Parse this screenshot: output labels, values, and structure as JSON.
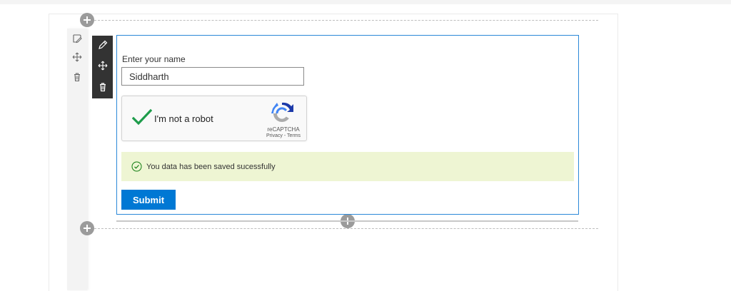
{
  "form": {
    "name_label": "Enter your name",
    "name_value": "Siddharth"
  },
  "recaptcha": {
    "checkbox_label": "I'm not a robot",
    "brand": "reCAPTCHA",
    "privacy_link": "Privacy",
    "separator": " - ",
    "terms_link": "Terms",
    "checked": true
  },
  "status": {
    "message": "You data has been saved sucessfully"
  },
  "actions": {
    "submit_label": "Submit"
  },
  "icons": {
    "section_left": [
      "edit-section-icon",
      "move-section-icon",
      "delete-section-icon"
    ],
    "toolbar": [
      "pencil-icon",
      "move-icon",
      "trash-icon"
    ],
    "add": "plus-icon",
    "success": "check-circle-icon",
    "check": "checkmark-icon"
  },
  "colors": {
    "accent": "#0078d4",
    "webpart_border": "#2b88d8",
    "success_bg": "#eef5d3",
    "check_green": "#1e9c4b",
    "toolbar_bg": "#333333"
  }
}
